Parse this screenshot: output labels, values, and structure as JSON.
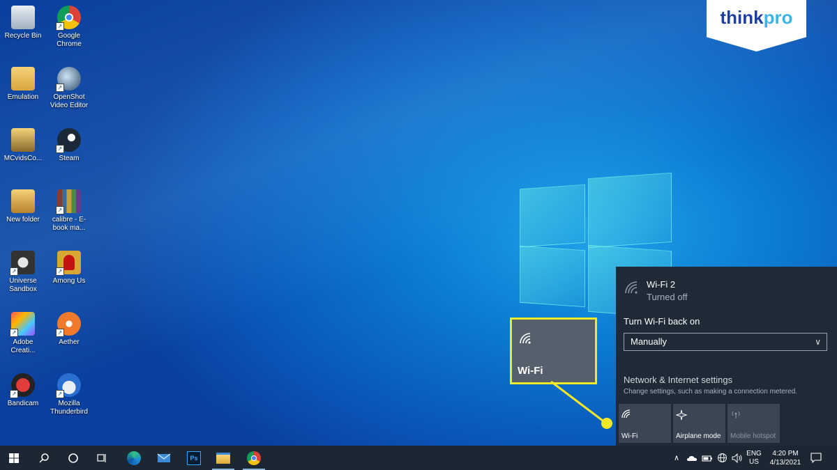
{
  "brand": {
    "think": "think",
    "pro": "pro"
  },
  "desktop_icons": [
    {
      "label": "Recycle Bin",
      "icon": "recycle-bin-icon"
    },
    {
      "label": "Google Chrome",
      "icon": "chrome-icon"
    },
    {
      "label": "Emulation",
      "icon": "folder-icon"
    },
    {
      "label": "OpenShot Video Editor",
      "icon": "openshot-icon"
    },
    {
      "label": "MCvidsCo...",
      "icon": "folder-icon"
    },
    {
      "label": "Steam",
      "icon": "steam-icon"
    },
    {
      "label": "New folder",
      "icon": "folder-icon"
    },
    {
      "label": "calibre - E-book ma...",
      "icon": "calibre-icon"
    },
    {
      "label": "Universe Sandbox",
      "icon": "universe-sandbox-icon"
    },
    {
      "label": "Among Us",
      "icon": "among-us-icon"
    },
    {
      "label": "Adobe Creati...",
      "icon": "adobe-cc-icon"
    },
    {
      "label": "Aether",
      "icon": "aether-icon"
    },
    {
      "label": "Bandicam",
      "icon": "bandicam-icon"
    },
    {
      "label": "Mozilla Thunderbird",
      "icon": "thunderbird-icon"
    }
  ],
  "highlight": {
    "label": "Wi-Fi"
  },
  "network_panel": {
    "network_name": "Wi-Fi 2",
    "network_status": "Turned off",
    "turn_back_label": "Turn Wi-Fi back on",
    "turn_back_value": "Manually",
    "settings_link": "Network & Internet settings",
    "settings_desc": "Change settings, such as making a connection metered.",
    "tiles": [
      {
        "label": "Wi-Fi",
        "icon": "wifi-icon",
        "enabled": true
      },
      {
        "label": "Airplane mode",
        "icon": "airplane-icon",
        "enabled": true
      },
      {
        "label": "Mobile hotspot",
        "icon": "hotspot-icon",
        "enabled": false
      }
    ]
  },
  "taskbar": {
    "apps": [
      "start-icon",
      "search-icon",
      "cortana-icon",
      "task-view-icon",
      "edge-icon",
      "mail-icon",
      "photoshop-icon",
      "file-explorer-icon",
      "chrome-icon"
    ],
    "ps_label": "Ps",
    "lang_top": "ENG",
    "lang_bottom": "US",
    "time": "4:20 PM",
    "date": "4/13/2021"
  },
  "colors": {
    "highlight": "#f3e826",
    "panel": "#1f2a36",
    "taskbar": "#1d2733"
  }
}
